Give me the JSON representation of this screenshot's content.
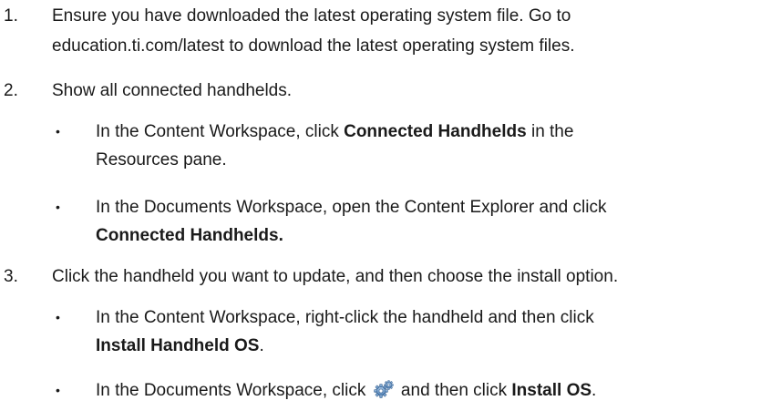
{
  "steps": [
    {
      "num": "1.",
      "line1": "Ensure you have downloaded the latest operating system file. Go to",
      "line2": "education.ti.com/latest to download the latest operating system files."
    },
    {
      "num": "2.",
      "text": "Show all connected handhelds.",
      "bullets": [
        {
          "dot": "•",
          "line1": "In the Content Workspace, click ",
          "line1_bold": "Connected Handhelds",
          "line1_after": " in the",
          "line2": "Resources pane."
        },
        {
          "dot": "•",
          "line1": "In the Documents Workspace, open the Content Explorer and click",
          "line2_bold": "Connected Handhelds."
        }
      ]
    },
    {
      "num": "3.",
      "text": "Click the handheld you want to update, and then choose the install option.",
      "bullets": [
        {
          "dot": "•",
          "line1": "In the Content Workspace, right-click the handheld and then click",
          "line2_bold": "Install Handheld OS",
          "line2_after": "."
        },
        {
          "dot": "•",
          "before_icon": "In the Documents Workspace, click ",
          "icon": "gear-icon",
          "after_icon": " and then click ",
          "bold": "Install OS",
          "after_bold": "."
        }
      ]
    }
  ]
}
